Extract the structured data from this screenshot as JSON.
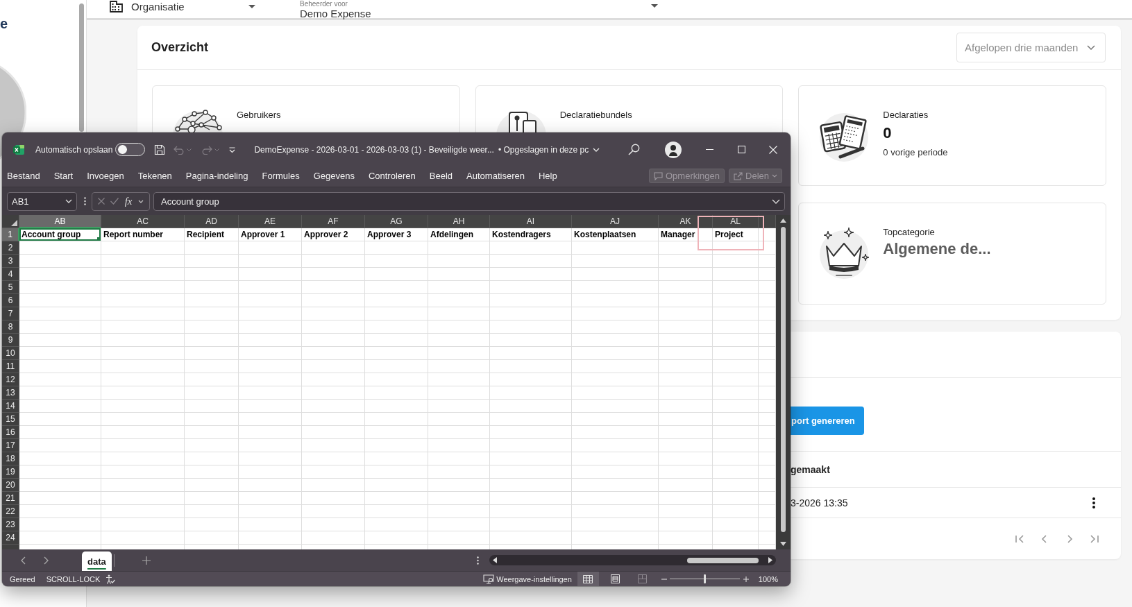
{
  "sidebar": {
    "text": "e"
  },
  "top_bar": {
    "organization": "Organisatie",
    "manager_label": "Beheerder voor",
    "manager": "Demo Expense"
  },
  "overview": {
    "title": "Overzicht",
    "period": "Afgelopen drie maanden",
    "stats": [
      {
        "kind": "users",
        "label": "Gebruikers"
      },
      {
        "kind": "bundles",
        "label": "Declaratiebundels"
      },
      {
        "kind": "expenses",
        "label": "Declaraties",
        "value": "0",
        "previous": "0 vorige periode"
      },
      {
        "kind": "category",
        "label": "Topcategorie",
        "value": "Algemene de..."
      }
    ]
  },
  "reports": {
    "button": "port genereren",
    "column_header": "gemaakt",
    "rows": [
      {
        "cell": "3-2026 13:35"
      }
    ]
  },
  "excel": {
    "autosave": {
      "label": "Automatisch opslaan",
      "on": false
    },
    "quick_access": [
      {
        "kind": "save",
        "disabled": false
      },
      {
        "kind": "undo",
        "disabled": true
      },
      {
        "kind": "redo",
        "disabled": true
      }
    ],
    "title": "DemoExpense - 2026-03-01 - 2026-03-03 (1) - Beveiligde weer...",
    "save_status": "• Opgeslagen in deze pc",
    "menu": [
      "Bestand",
      "Start",
      "Invoegen",
      "Tekenen",
      "Pagina-indeling",
      "Formules",
      "Gegevens",
      "Controleren",
      "Beeld",
      "Automatiseren",
      "Help"
    ],
    "actions": [
      {
        "kind": "comments",
        "label": "Opmerkingen",
        "disabled": true
      },
      {
        "kind": "share",
        "label": "Delen",
        "disabled": true
      }
    ],
    "name_box": "AB1",
    "function_label": "fx",
    "formula": "Account group",
    "columns": [
      {
        "label": "AB",
        "selected": true,
        "cell": "Account group"
      },
      {
        "label": "AC",
        "selected": false,
        "cell": "Report number"
      },
      {
        "label": "AD",
        "selected": false,
        "cell": "Recipient"
      },
      {
        "label": "AE",
        "selected": false,
        "cell": "Approver 1"
      },
      {
        "label": "AF",
        "selected": false,
        "cell": "Approver 2"
      },
      {
        "label": "AG",
        "selected": false,
        "cell": "Approver 3"
      },
      {
        "label": "AH",
        "selected": false,
        "cell": "Afdelingen"
      },
      {
        "label": "AI",
        "selected": false,
        "cell": "Kostendragers"
      },
      {
        "label": "AJ",
        "selected": false,
        "cell": "Kostenplaatsen"
      },
      {
        "label": "AK",
        "selected": false,
        "cell": "Manager"
      },
      {
        "label": "AL",
        "selected": false,
        "cell": "Project"
      }
    ],
    "rows": [
      {
        "label": "1",
        "selected": true
      },
      {
        "label": "2",
        "selected": false
      },
      {
        "label": "3",
        "selected": false
      },
      {
        "label": "4",
        "selected": false
      },
      {
        "label": "5",
        "selected": false
      },
      {
        "label": "6",
        "selected": false
      },
      {
        "label": "7",
        "selected": false
      },
      {
        "label": "8",
        "selected": false
      },
      {
        "label": "9",
        "selected": false
      },
      {
        "label": "10",
        "selected": false
      },
      {
        "label": "11",
        "selected": false
      },
      {
        "label": "12",
        "selected": false
      },
      {
        "label": "13",
        "selected": false
      },
      {
        "label": "14",
        "selected": false
      },
      {
        "label": "15",
        "selected": false
      },
      {
        "label": "16",
        "selected": false
      },
      {
        "label": "17",
        "selected": false
      },
      {
        "label": "18",
        "selected": false
      },
      {
        "label": "19",
        "selected": false
      },
      {
        "label": "20",
        "selected": false
      },
      {
        "label": "21",
        "selected": false
      },
      {
        "label": "22",
        "selected": false
      },
      {
        "label": "23",
        "selected": false
      },
      {
        "label": "24",
        "selected": false
      }
    ],
    "sheets": [
      {
        "label": "data",
        "selected": true
      }
    ],
    "status": [
      "Gereed",
      "SCROLL-LOCK"
    ],
    "view_settings": "Weergave-instellingen",
    "views": [
      {
        "kind": "normal",
        "selected": true
      },
      {
        "kind": "page_layout",
        "selected": false
      },
      {
        "kind": "page_break",
        "selected": false
      }
    ],
    "zoom": {
      "level": 0.5,
      "reading": "100%"
    }
  }
}
